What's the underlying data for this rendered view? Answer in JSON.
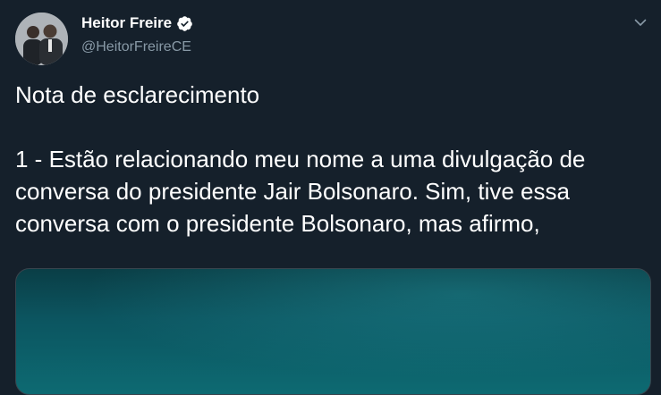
{
  "author": {
    "display_name": "Heitor Freire",
    "handle": "@HeitorFreireCE",
    "verified": true,
    "avatar_icon": "profile-photo"
  },
  "tweet": {
    "title_line": "Nota de esclarecimento",
    "body": "1 - Estão relacionando meu nome a uma divulgação de conversa do presidente Jair Bolsonaro. Sim, tive essa conversa com o presidente Bolsonaro, mas afirmo,"
  },
  "icons": {
    "verified": "verified-badge-icon",
    "menu": "chevron-down-icon"
  },
  "colors": {
    "background": "#15202b",
    "secondary_text": "#8899a6",
    "accent": "#1da1f2"
  }
}
